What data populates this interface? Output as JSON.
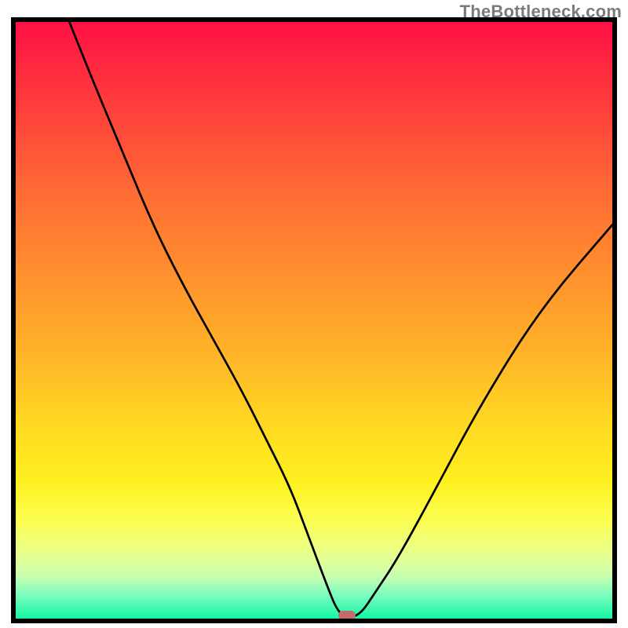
{
  "watermark": "TheBottleneck.com",
  "colors": {
    "border": "#000000",
    "pip": "#c36b6b",
    "gradient_stops": [
      "#ff1046",
      "#ff2b3f",
      "#ff4a3a",
      "#ff6a35",
      "#ff8a2f",
      "#ffb228",
      "#ffda22",
      "#fef01f",
      "#faff56",
      "#e9ff8b",
      "#c7ffb1",
      "#7dfcc0",
      "#14f6a4"
    ]
  },
  "chart_data": {
    "type": "line",
    "title": "",
    "xlabel": "",
    "ylabel": "",
    "xlim": [
      0,
      100
    ],
    "ylim": [
      0,
      100
    ],
    "grid": false,
    "legend": false,
    "note": "x,y are normalized to the plot frame (0=left/top, 100=right/bottom after y-flip). Curve is a V-shaped bottleneck profile: steep descent, flat trough near x≈52–57, then rising again. y shown is height-above-minimum as percent of plot height.",
    "series": [
      {
        "name": "bottleneck-curve",
        "x": [
          9,
          13,
          18,
          23,
          28,
          33,
          38,
          42,
          46,
          49,
          52,
          54,
          56,
          58,
          60,
          64,
          70,
          78,
          88,
          100
        ],
        "y": [
          100,
          90,
          78,
          66,
          56,
          47,
          38,
          30,
          22,
          14,
          6,
          1,
          0,
          1,
          4,
          10,
          21,
          36,
          52,
          66
        ]
      }
    ],
    "marker": {
      "name": "trough-pip",
      "x": 55.5,
      "y": 0
    }
  }
}
